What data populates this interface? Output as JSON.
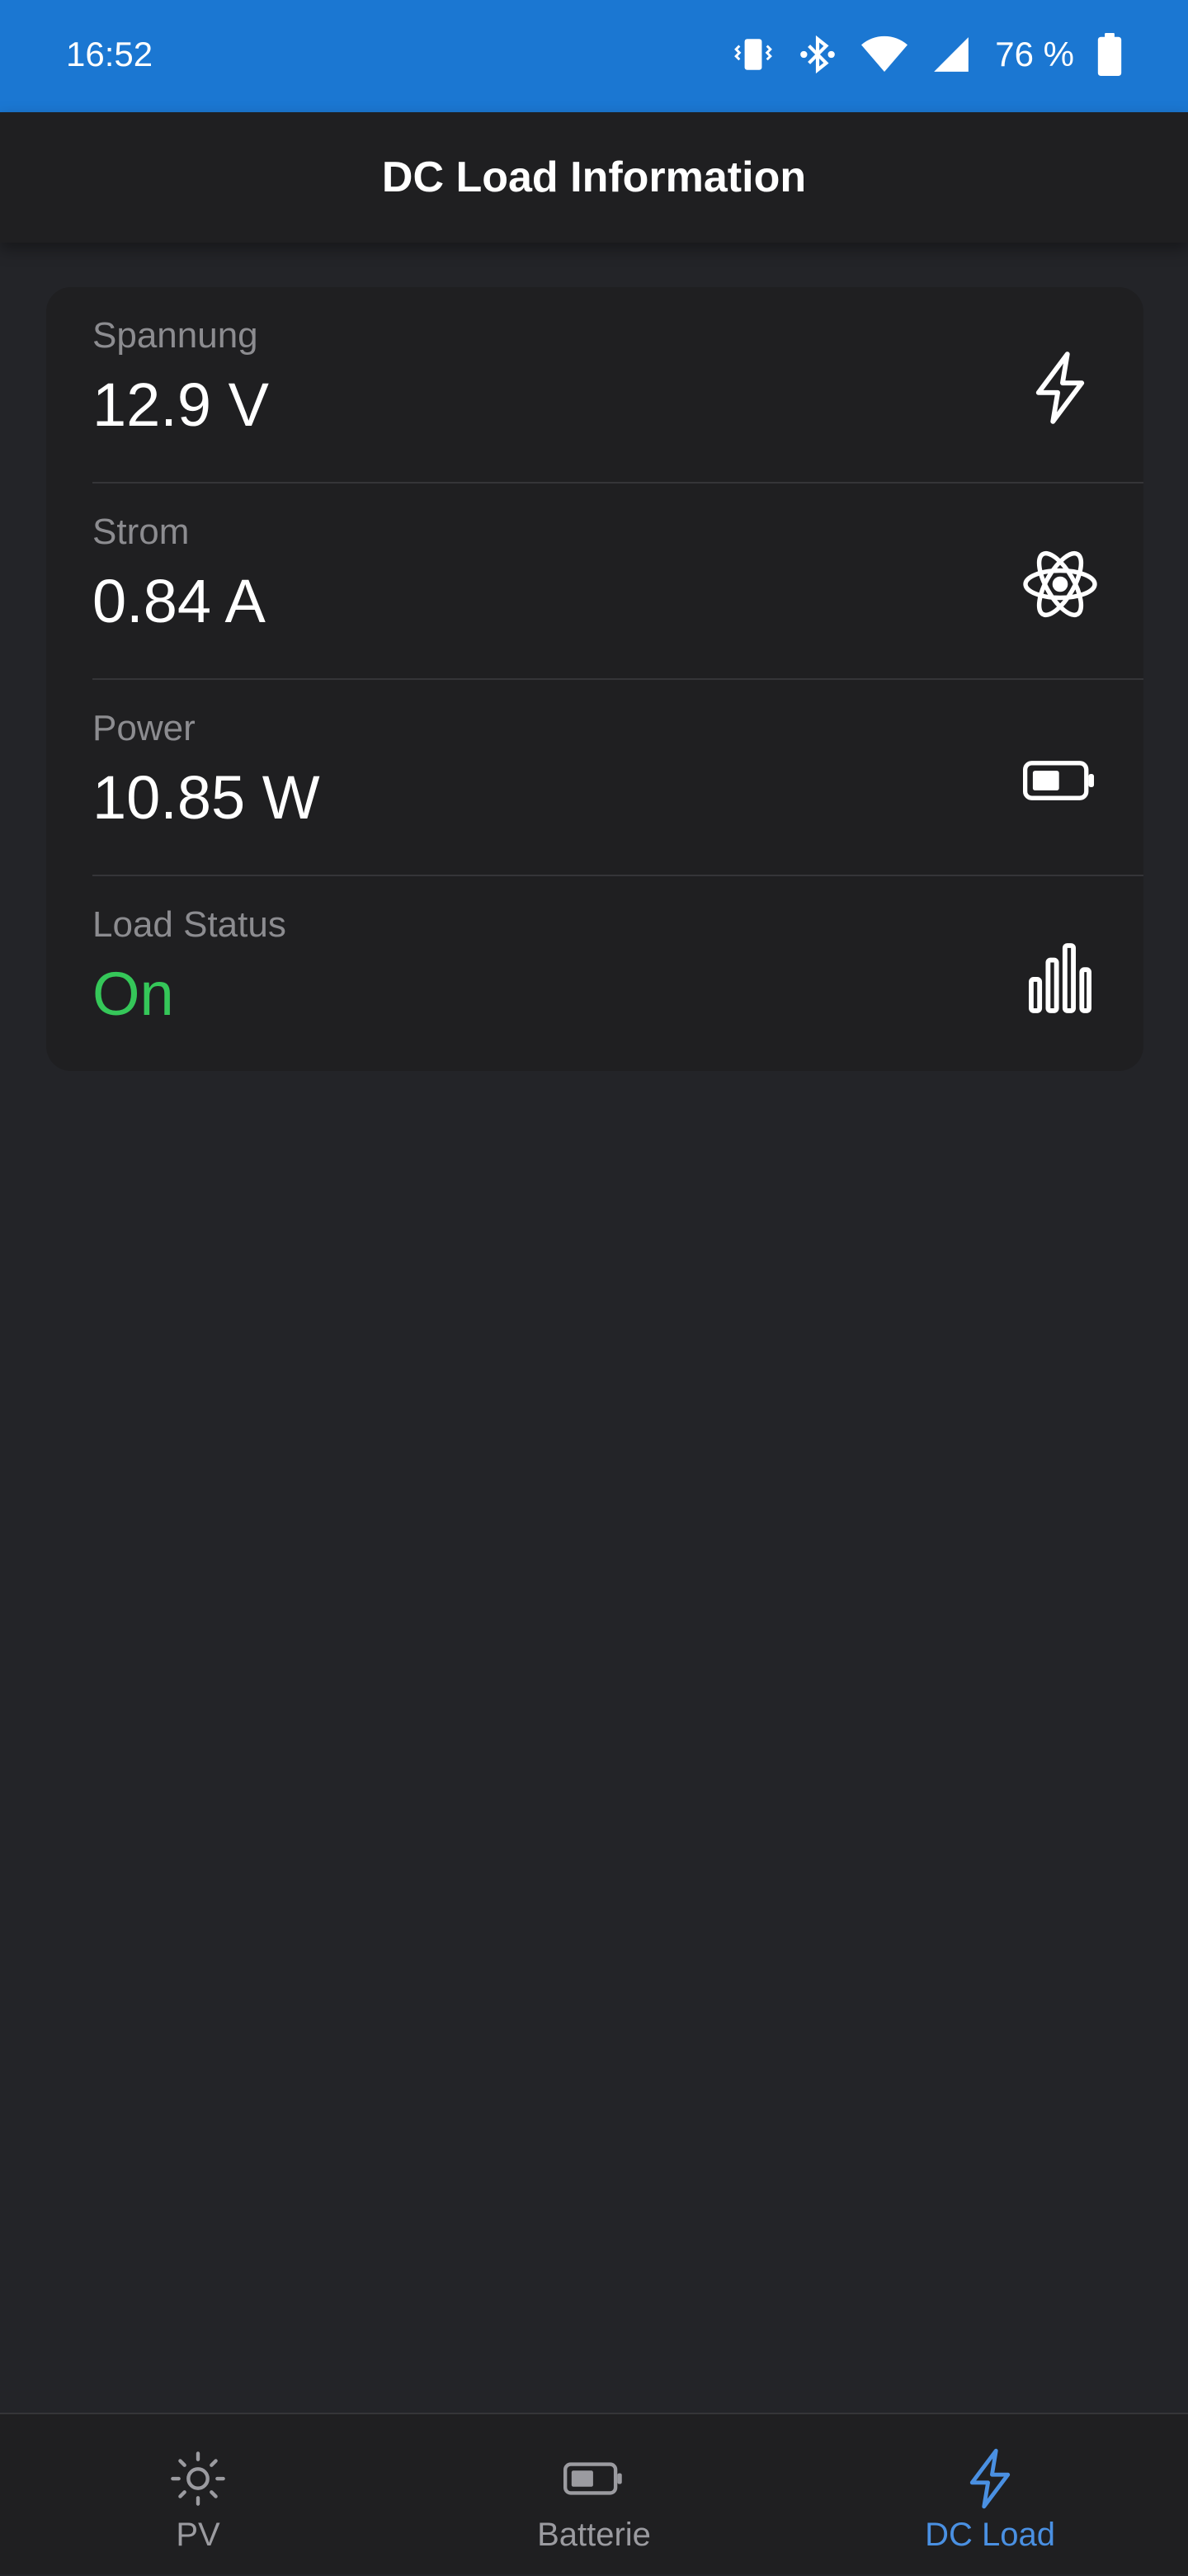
{
  "status_bar": {
    "time": "16:52",
    "battery_percent": "76 %",
    "icons": [
      "vibrate-icon",
      "bluetooth-icon",
      "wifi-icon",
      "signal-icon",
      "battery-icon"
    ]
  },
  "app_bar": {
    "title": "DC Load Information"
  },
  "metrics": [
    {
      "label": "Spannung",
      "value": "12.9 V",
      "icon": "lightning-bolt-icon"
    },
    {
      "label": "Strom",
      "value": "0.84 A",
      "icon": "atom-icon"
    },
    {
      "label": "Power",
      "value": "10.85 W",
      "icon": "battery-half-icon"
    },
    {
      "label": "Load Status",
      "value": "On",
      "icon": "bar-chart-icon",
      "value_color": "#35c759"
    }
  ],
  "bottom_nav": {
    "active": "DC Load",
    "active_color": "#4a90e2",
    "items": [
      {
        "label": "PV",
        "icon": "sun-icon"
      },
      {
        "label": "Batterie",
        "icon": "battery-icon"
      },
      {
        "label": "DC Load",
        "icon": "lightning-bolt-icon"
      }
    ]
  }
}
